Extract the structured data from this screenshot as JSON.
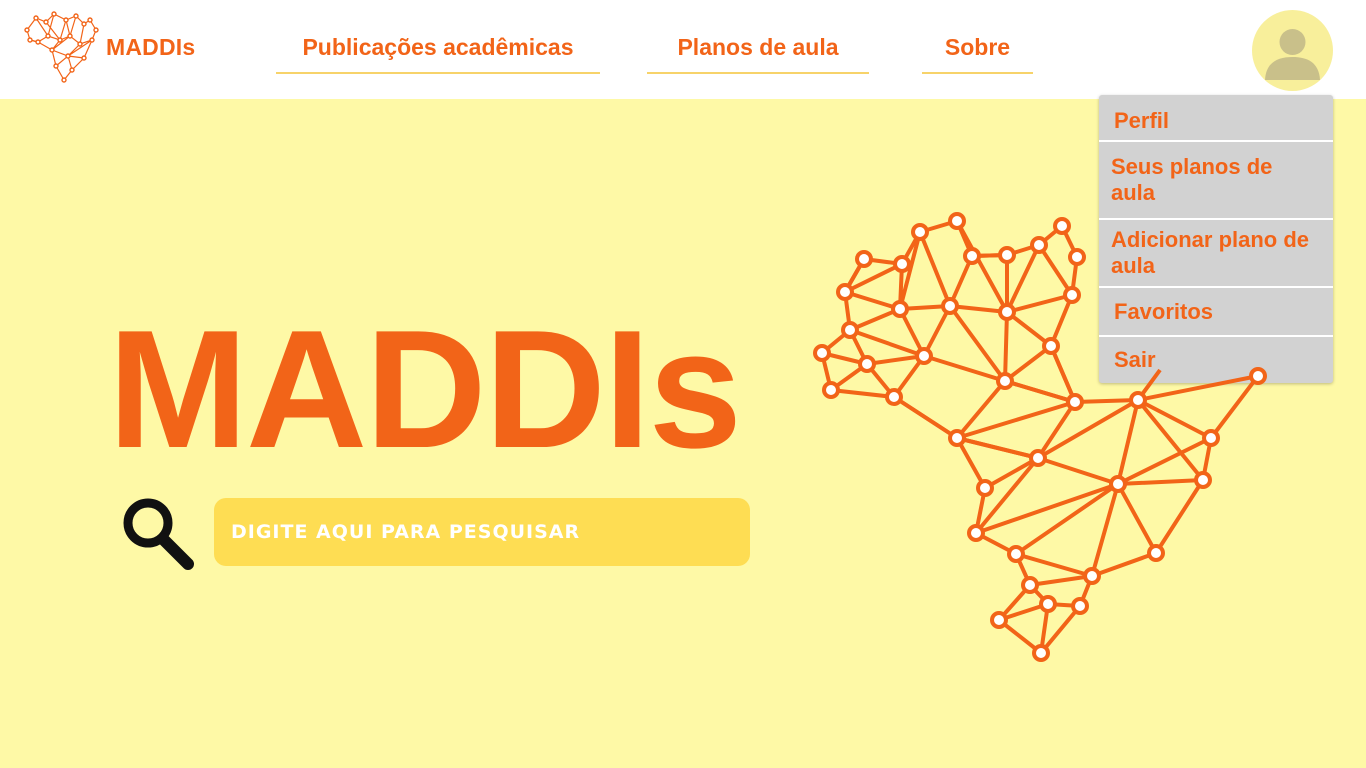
{
  "brand": {
    "name": "MADDIs"
  },
  "nav": {
    "items": [
      {
        "label": "Publicações acadêmicas"
      },
      {
        "label": "Planos de aula"
      },
      {
        "label": "Sobre"
      }
    ]
  },
  "user_menu": {
    "avatar_icon": "user-avatar-icon",
    "items": [
      {
        "label": "Perfil"
      },
      {
        "label": "Seus planos de aula"
      },
      {
        "label": "Adicionar plano de aula"
      },
      {
        "label": "Favoritos"
      },
      {
        "label": "Sair"
      }
    ]
  },
  "hero": {
    "title": "MADDIs",
    "search": {
      "placeholder": "DIGITE AQUI PARA PESQUISAR",
      "value": "",
      "icon": "search-icon"
    },
    "illustration": "brazil-network-map"
  },
  "colors": {
    "accent": "#f26418",
    "background": "#fef9a6",
    "search_box": "#fedd53",
    "menu": "#d2d2d2"
  }
}
